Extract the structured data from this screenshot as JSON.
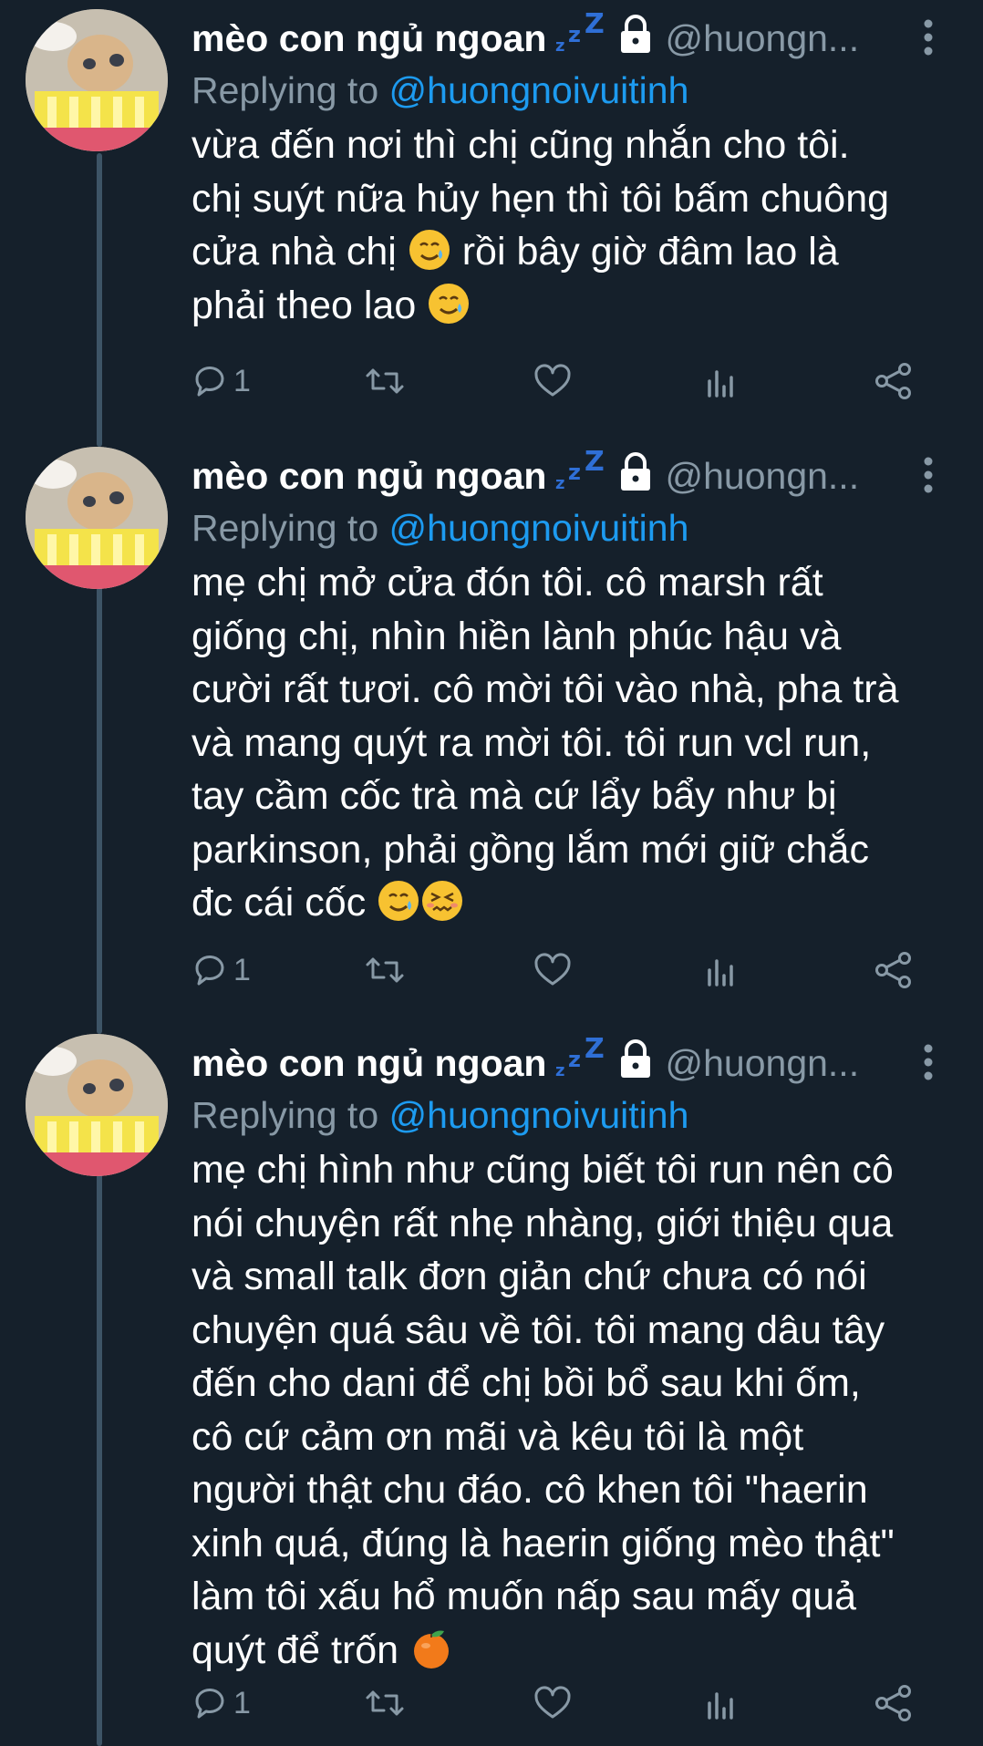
{
  "tweets": [
    {
      "author_name": "mèo con ngủ ngoan",
      "sleep_mark": "zzZ",
      "handle": "@huongn...",
      "replying_prefix": "Replying to",
      "replying_handle": "@huongnoivuitinh",
      "text": "vừa đến nơi thì chị cũng nhắn cho tôi.\nchị suýt nữa hủy hẹn thì tôi bấm chuông\ncửa nhà chị ",
      "text_b": " rồi bây giờ đâm lao là\nphải theo lao ",
      "emojis": [
        "smiling-face-with-tear",
        "smiling-face-with-tear"
      ],
      "reply_count": "1"
    },
    {
      "author_name": "mèo con ngủ ngoan",
      "sleep_mark": "zzZ",
      "handle": "@huongn...",
      "replying_prefix": "Replying to",
      "replying_handle": "@huongnoivuitinh",
      "text": "mẹ chị mở cửa đón tôi. cô marsh rất\ngiống chị, nhìn hiền lành phúc hậu và\ncười rất tươi. cô mời tôi vào nhà, pha trà\nvà mang quýt ra mời tôi. tôi run vcl run,\ntay cầm cốc trà mà cứ lẩy bẩy như bị\nparkinson, phải gồng lắm mới giữ chắc\nđc cái cốc ",
      "emojis": [
        "smiling-face-with-tear",
        "confounded-face"
      ],
      "reply_count": "1"
    },
    {
      "author_name": "mèo con ngủ ngoan",
      "sleep_mark": "zzZ",
      "handle": "@huongn...",
      "replying_prefix": "Replying to",
      "replying_handle": "@huongnoivuitinh",
      "text": "mẹ chị hình như cũng biết tôi run nên cô\nnói chuyện rất nhẹ nhàng, giới thiệu qua\nvà small talk đơn giản chứ chưa có nói\nchuyện quá sâu về tôi. tôi mang dâu tây\nđến cho dani để chị bồi bổ sau khi ốm,\ncô cứ cảm ơn mãi và kêu tôi là một\nngười thật chu đáo. cô khen tôi \"haerin\nxinh quá, đúng là haerin giống mèo thật\"\nlàm tôi xấu hổ muốn nấp sau mấy quả\nquýt để trốn ",
      "emojis": [
        "tangerine"
      ],
      "reply_count": "1"
    }
  ],
  "colors": {
    "background": "#15202b",
    "secondary_text": "#8899a6",
    "link": "#1d9bf0",
    "thread_line": "#3d5466"
  },
  "icons": [
    "reply-icon",
    "retweet-icon",
    "like-icon",
    "stats-icon",
    "share-icon",
    "more-icon",
    "lock-icon"
  ]
}
